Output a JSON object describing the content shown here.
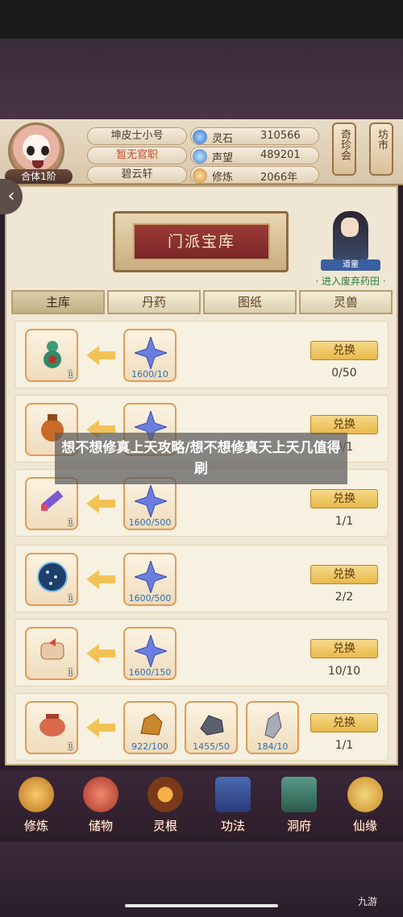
{
  "header": {
    "rank": "合体1阶",
    "name": "坤皮士小号",
    "title": "暂无官职",
    "home": "碧云轩",
    "stats": [
      {
        "label": "灵石",
        "value": "310566",
        "icon": "spirit-stone-icon"
      },
      {
        "label": "声望",
        "value": "489201",
        "icon": "prestige-icon"
      },
      {
        "label": "修炼",
        "value": "2066年",
        "icon": "cultivation-icon"
      }
    ],
    "side_buttons": [
      "奇珍会",
      "坊市"
    ]
  },
  "panel": {
    "banner_title": "门派宝库",
    "npc_tag": "道童",
    "npc_link": "· 进入废弃药田 ·",
    "tabs": [
      "主库",
      "丹药",
      "图纸",
      "灵兽"
    ]
  },
  "rows": [
    {
      "reward_icon": "gourd-icon",
      "reward_count": "1",
      "costs": [
        {
          "icon": "star-shuriken-icon",
          "req": "1600/10"
        }
      ],
      "button": "兑换",
      "limit": "0/50"
    },
    {
      "reward_icon": "pouch-icon",
      "reward_count": "1",
      "costs": [
        {
          "icon": "star-shuriken-icon",
          "req": ""
        }
      ],
      "button": "兑换",
      "limit": "0/1"
    },
    {
      "reward_icon": "scroll-sword-icon",
      "reward_count": "1",
      "costs": [
        {
          "icon": "star-shuriken-icon",
          "req": "1600/500"
        }
      ],
      "button": "兑换",
      "limit": "1/1"
    },
    {
      "reward_icon": "star-disc-icon",
      "reward_count": "1",
      "costs": [
        {
          "icon": "star-shuriken-icon",
          "req": "1600/500"
        }
      ],
      "button": "兑换",
      "limit": "2/2"
    },
    {
      "reward_icon": "paper-scroll-icon",
      "reward_count": "1",
      "costs": [
        {
          "icon": "star-shuriken-icon",
          "req": "1600/150"
        }
      ],
      "button": "兑换",
      "limit": "10/10"
    },
    {
      "reward_icon": "cauldron-icon",
      "reward_count": "1",
      "costs": [
        {
          "icon": "gold-ore-icon",
          "req": "922/100"
        },
        {
          "icon": "iron-ore-icon",
          "req": "1455/50"
        },
        {
          "icon": "silver-ore-icon",
          "req": "184/10"
        }
      ],
      "button": "兑换",
      "limit": "1/1"
    }
  ],
  "nav": [
    "修炼",
    "储物",
    "灵根",
    "功法",
    "洞府",
    "仙缘"
  ],
  "caption": "想不想修真上天攻略/想不想修真天上天几值得刷",
  "watermark": "九游",
  "colors": {
    "accent": "#e19b56",
    "exchange_button": "#e9b94a",
    "panel": "#efe7d4"
  }
}
